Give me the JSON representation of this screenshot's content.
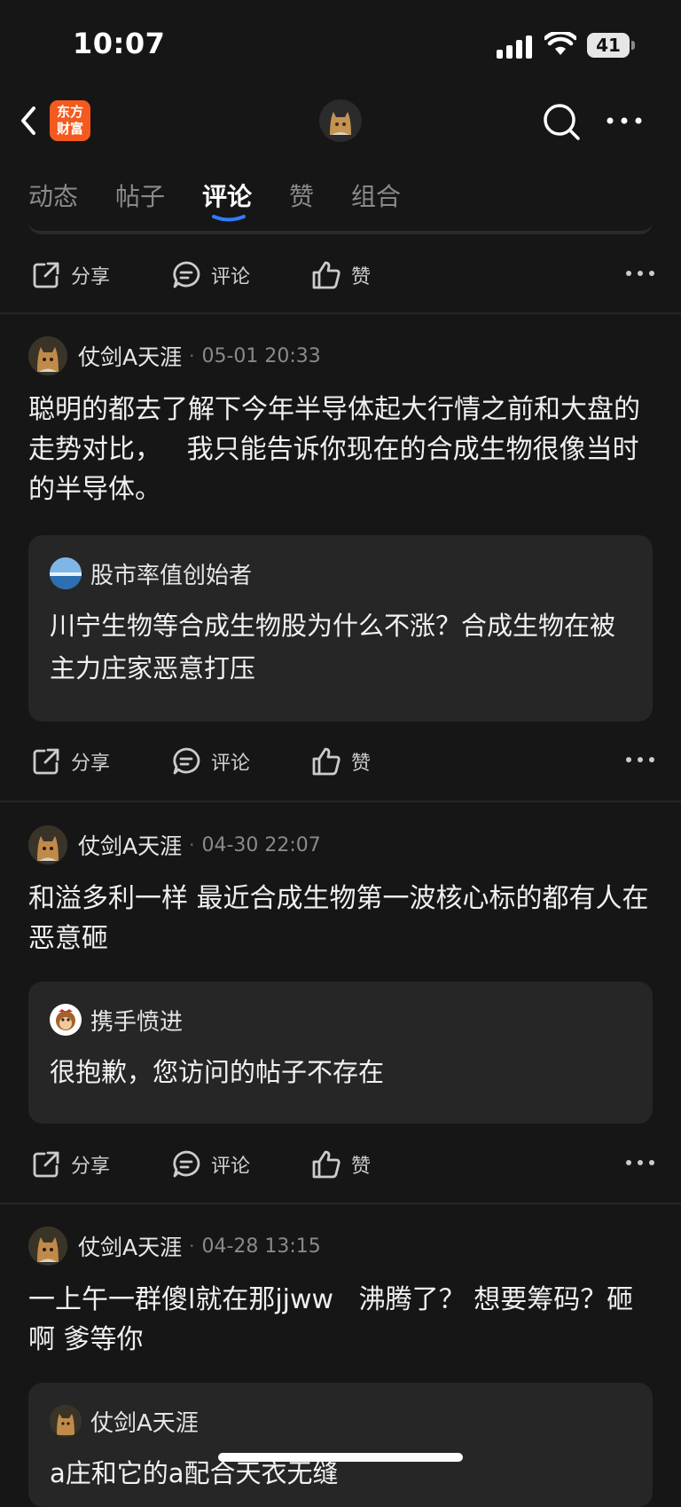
{
  "status_bar": {
    "time": "10:07",
    "battery": "41"
  },
  "nav": {
    "logo_line1": "东方",
    "logo_line2": "财富"
  },
  "tabs": [
    {
      "label": "动态",
      "active": false
    },
    {
      "label": "帖子",
      "active": false
    },
    {
      "label": "评论",
      "active": true
    },
    {
      "label": "赞",
      "active": false
    },
    {
      "label": "组合",
      "active": false
    }
  ],
  "actions": {
    "share": "分享",
    "comment": "评论",
    "like": "赞"
  },
  "posts": [
    {
      "author": "仗剑A天涯",
      "time": "05-01 20:33",
      "body": "聪明的都去了解下今年半导体起大行情之前和大盘的走势对比，   我只能告诉你现在的合成生物很像当时的半导体。",
      "quote": {
        "author": "股市率值创始者",
        "text": "川宁生物等合成生物股为什么不涨？合成生物在被主力庄家恶意打压"
      }
    },
    {
      "author": "仗剑A天涯",
      "time": "04-30 22:07",
      "body": "和溢多利一样 最近合成生物第一波核心标的都有人在恶意砸",
      "quote": {
        "author": "携手愤进",
        "text": "很抱歉，您访问的帖子不存在"
      }
    },
    {
      "author": "仗剑A天涯",
      "time": "04-28 13:15",
      "body": "一上午一群傻l就在那jjww   沸腾了？ 想要筹码？砸啊 爹等你",
      "quote": {
        "author": "仗剑A天涯",
        "text": "a庄和它的a配合天衣无缝"
      }
    }
  ]
}
